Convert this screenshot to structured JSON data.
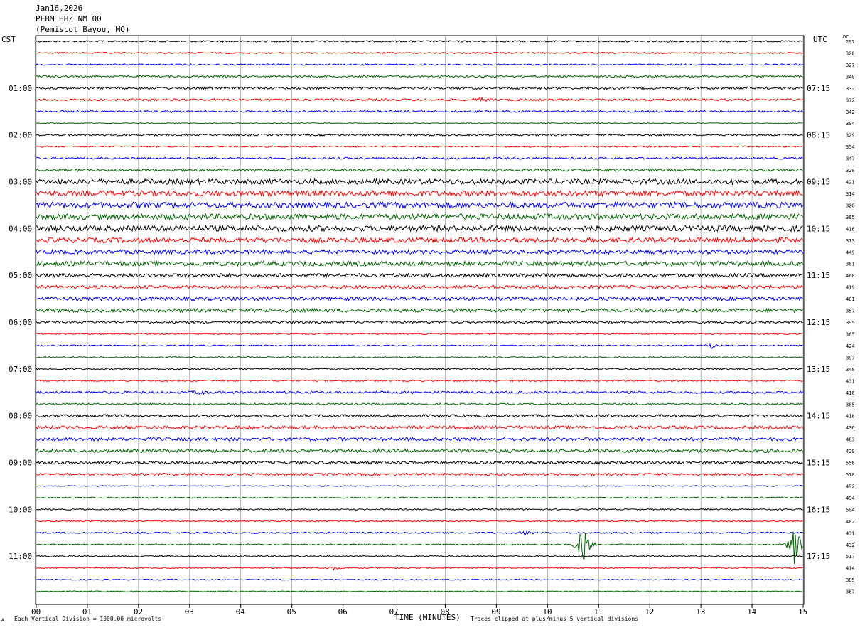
{
  "header": {
    "date": "Jan16,2026",
    "station": "PEBM HHZ NM 00",
    "location": "(Pemiscot Bayou, MO)"
  },
  "left_timezone": "CST",
  "right_timezone": "UTC",
  "dc_label": "DC",
  "footer": {
    "scale_note": "Each Vertical Division = 1000.00 microvolts",
    "clip_note": "Traces clipped at plus/minus 5 vertical divisions",
    "corner_mark": "A"
  },
  "colors": {
    "trace_cycle": [
      "#000000",
      "#ff0000",
      "#0000ff",
      "#006400"
    ],
    "grid": "#888888"
  },
  "chart_data": {
    "type": "line",
    "chart_kind": "helicorder seismogram",
    "xlabel": "TIME (MINUTES)",
    "x_range": [
      0,
      15
    ],
    "x_ticks": [
      "00",
      "01",
      "02",
      "03",
      "04",
      "05",
      "06",
      "07",
      "08",
      "09",
      "10",
      "11",
      "12",
      "13",
      "14",
      "15"
    ],
    "grid": "vertical lines each minute",
    "row_count": 48,
    "row_minutes": 15,
    "left_hour_labels": [
      "01:00",
      "02:00",
      "03:00",
      "04:00",
      "05:00",
      "06:00",
      "07:00",
      "08:00",
      "09:00",
      "10:00",
      "11:00"
    ],
    "right_hour_labels": [
      "07:15",
      "08:15",
      "09:15",
      "10:15",
      "11:15",
      "12:15",
      "13:15",
      "14:15",
      "15:15",
      "16:15",
      "17:15"
    ],
    "dc_offsets": [
      297,
      320,
      327,
      340,
      332,
      372,
      342,
      304,
      329,
      354,
      347,
      320,
      421,
      314,
      326,
      365,
      416,
      313,
      449,
      381,
      460,
      419,
      401,
      357,
      395,
      385,
      424,
      397,
      340,
      431,
      416,
      385,
      418,
      436,
      483,
      429,
      556,
      570,
      492,
      494,
      504,
      482,
      431,
      432,
      517,
      414,
      385,
      367
    ],
    "row_noise_level": [
      1.1,
      1.0,
      1.0,
      1.3,
      1.6,
      1.5,
      1.3,
      0.6,
      1.3,
      1.0,
      1.4,
      1.8,
      3.6,
      3.9,
      4.0,
      3.9,
      4.0,
      3.6,
      2.9,
      3.2,
      2.6,
      2.3,
      2.6,
      2.6,
      1.6,
      0.9,
      0.9,
      0.9,
      1.1,
      1.1,
      1.6,
      1.2,
      1.8,
      2.3,
      2.3,
      2.3,
      2.1,
      1.6,
      0.7,
      0.9,
      0.9,
      0.9,
      1.1,
      0.9,
      0.9,
      0.9,
      0.8,
      0.7
    ],
    "events": [
      {
        "row": 5,
        "minute": 8.7,
        "amplitude": 3
      },
      {
        "row": 26,
        "minute": 13.2,
        "amplitude": 4
      },
      {
        "row": 30,
        "minute": 3.2,
        "amplitude": 3
      },
      {
        "row": 42,
        "minute": 9.6,
        "amplitude": 3
      },
      {
        "row": 43,
        "minute": 10.7,
        "amplitude": 40
      },
      {
        "row": 43,
        "minute": 14.85,
        "amplitude": 40
      },
      {
        "row": 45,
        "minute": 5.8,
        "amplitude": 3
      }
    ]
  }
}
